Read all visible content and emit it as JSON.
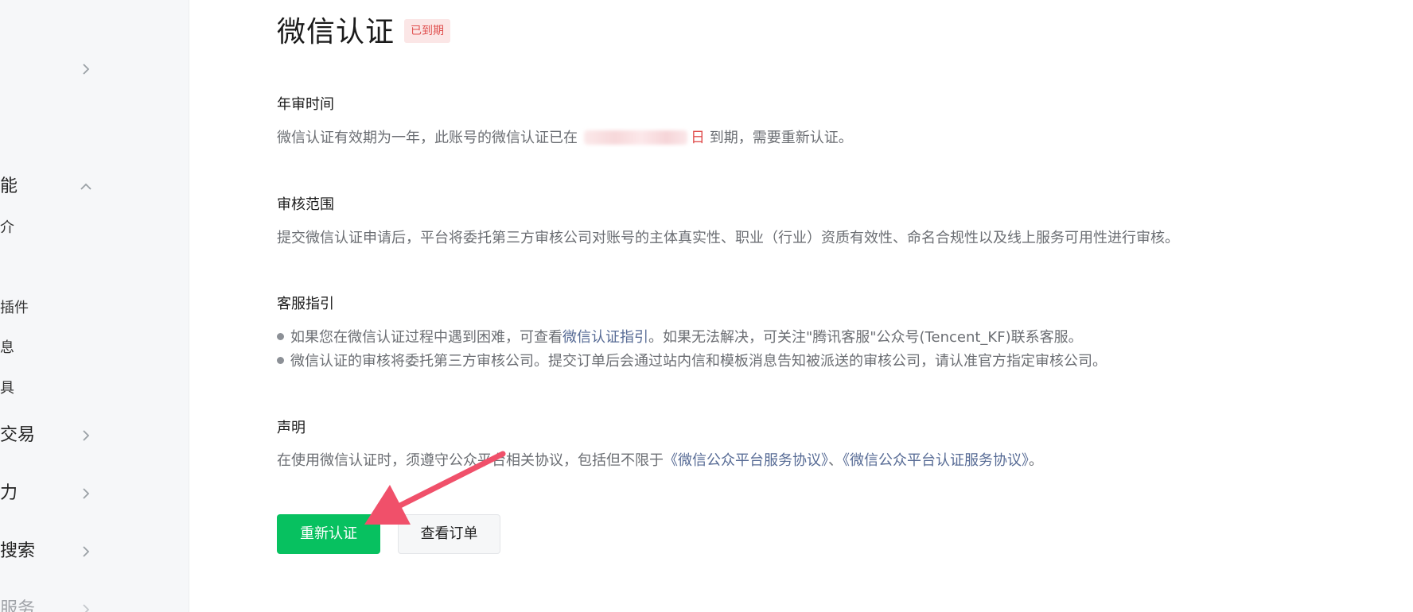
{
  "sidebar": {
    "items": [
      {
        "label": "",
        "chevron": "chevron-right-icon"
      },
      {
        "label": "能",
        "chevron": "chevron-up-icon"
      },
      {
        "label": "介"
      },
      {
        "label": "插件"
      },
      {
        "label": "息"
      },
      {
        "label": "具"
      },
      {
        "label": "交易",
        "chevron": "chevron-right-icon"
      },
      {
        "label": "力",
        "chevron": "chevron-right-icon"
      },
      {
        "label": "搜索",
        "chevron": "chevron-right-icon"
      },
      {
        "label": "服务",
        "chevron": "chevron-right-icon"
      }
    ]
  },
  "header": {
    "title": "微信认证",
    "status": "已到期"
  },
  "sections": {
    "annual_review": {
      "heading": "年审时间",
      "text_before": "微信认证有效期为一年，此账号的微信认证已在",
      "date_suffix": "日",
      "text_after": "到期，需要重新认证。"
    },
    "review_scope": {
      "heading": "审核范围",
      "text": "提交微信认证申请后，平台将委托第三方审核公司对账号的主体真实性、职业（行业）资质有效性、命名合规性以及线上服务可用性进行审核。"
    },
    "support": {
      "heading": "客服指引",
      "bullet1_before": "如果您在微信认证过程中遇到困难，可查看",
      "bullet1_link": "微信认证指引",
      "bullet1_after": "。如果无法解决，可关注\"腾讯客服\"公众号(Tencent_KF)联系客服。",
      "bullet2": "微信认证的审核将委托第三方审核公司。提交订单后会通过站内信和模板消息告知被派送的审核公司，请认准官方指定审核公司。"
    },
    "statement": {
      "heading": "声明",
      "text_before": "在使用微信认证时，须遵守公众平台相关协议，包括但不限于",
      "link1": "《微信公众平台服务协议》",
      "separator": "、",
      "link2": "《微信公众平台认证服务协议》",
      "text_after": "。"
    }
  },
  "actions": {
    "recertify_label": "重新认证",
    "view_orders_label": "查看订单"
  },
  "colors": {
    "primary": "#07c160",
    "link": "#576b95",
    "danger": "#e0504f",
    "annotation_arrow": "#f0506a"
  }
}
